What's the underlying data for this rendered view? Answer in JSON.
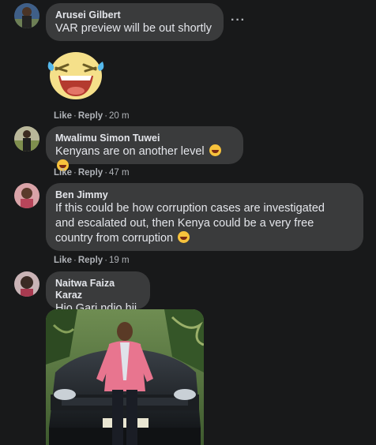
{
  "comments": [
    {
      "author": "Arusei Gilbert",
      "text": "VAR preview will be out shortly",
      "like": "Like",
      "reply": "Reply",
      "time": "20 m"
    },
    {
      "author": "Mwalimu Simon Tuwei",
      "text": "Kenyans are on another level",
      "like": "Like",
      "reply": "Reply",
      "time": "47 m"
    },
    {
      "author": "Ben Jimmy",
      "text_lines": [
        "If this could be how corruption cases are investigated",
        "and escalated out, then Kenya could be a very free",
        "country from corruption"
      ],
      "like": "Like",
      "reply": "Reply",
      "time": "19 m"
    },
    {
      "author": "Naitwa Faiza Karaz",
      "text": "Hio Gari ndio hii"
    }
  ],
  "more_options": "···",
  "icons": {
    "sticker": "laughing-tears-sticker",
    "inline": "rolling-on-floor-laughing-emoji",
    "more": "more-options-icon"
  },
  "colors": {
    "background": "#18191a",
    "bubble": "#3a3b3c",
    "text": "#e4e6eb",
    "secondary": "#b0b3b8",
    "sticker_yellow": "#f5e08a"
  }
}
